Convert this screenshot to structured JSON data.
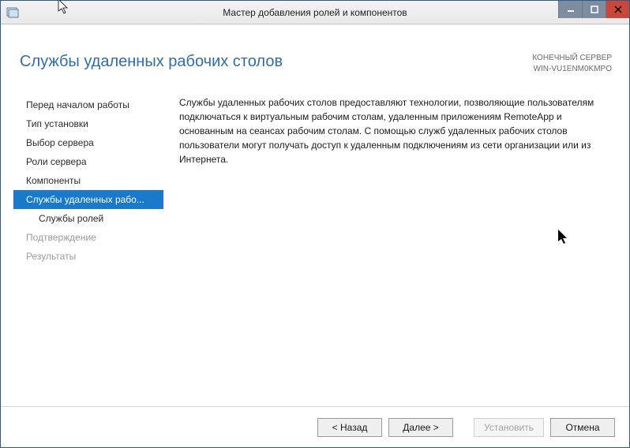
{
  "window": {
    "title": "Мастер добавления ролей и компонентов"
  },
  "header": {
    "page_title": "Службы удаленных рабочих столов",
    "server_label": "КОНЕЧНЫЙ СЕРВЕР",
    "server_name": "WIN-VU1ENM0KMPO"
  },
  "sidebar": {
    "items": [
      {
        "label": "Перед началом работы"
      },
      {
        "label": "Тип установки"
      },
      {
        "label": "Выбор сервера"
      },
      {
        "label": "Роли сервера"
      },
      {
        "label": "Компоненты"
      },
      {
        "label": "Службы удаленных рабо..."
      },
      {
        "label": "Службы ролей"
      },
      {
        "label": "Подтверждение"
      },
      {
        "label": "Результаты"
      }
    ]
  },
  "main": {
    "description": "Службы удаленных рабочих столов предоставляют технологии, позволяющие пользователям подключаться к виртуальным рабочим столам, удаленным приложениям RemoteApp и основанным на сеансах рабочим столам. С помощью служб удаленных рабочих столов пользователи могут получать доступ к удаленным подключениям из сети организации или из Интернета."
  },
  "footer": {
    "back": "< Назад",
    "next": "Далее >",
    "install": "Установить",
    "cancel": "Отмена"
  }
}
